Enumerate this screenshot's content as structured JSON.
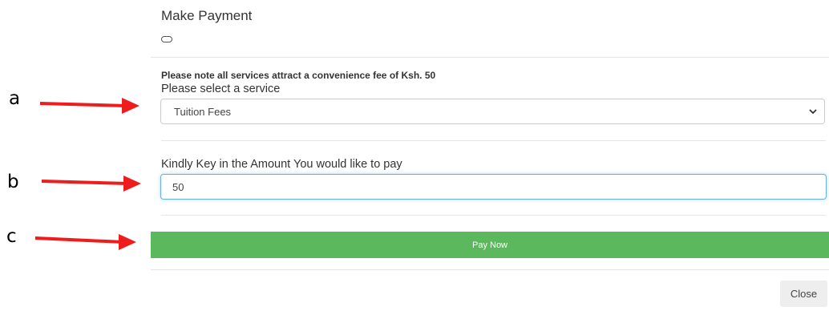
{
  "modal": {
    "title": "Make Payment",
    "fee_note": "Please note all services attract a convenience fee of Ksh. 50",
    "service_label": "Please select a service",
    "service_selected": "Tuition Fees",
    "amount_label": "Kindly Key in the Amount You would like to pay",
    "amount_value": "50",
    "pay_button": "Pay Now",
    "close_button": "Close"
  },
  "annotations": {
    "a": "a",
    "b": "b",
    "c": "c",
    "arrow_color": "#ee1c1c"
  },
  "colors": {
    "pay_button": "#5cb85c",
    "input_focus_border": "#66afe9"
  },
  "icons": {
    "select_chevron": "chevron-down-icon",
    "header_pill": "collapse-pill-icon"
  }
}
